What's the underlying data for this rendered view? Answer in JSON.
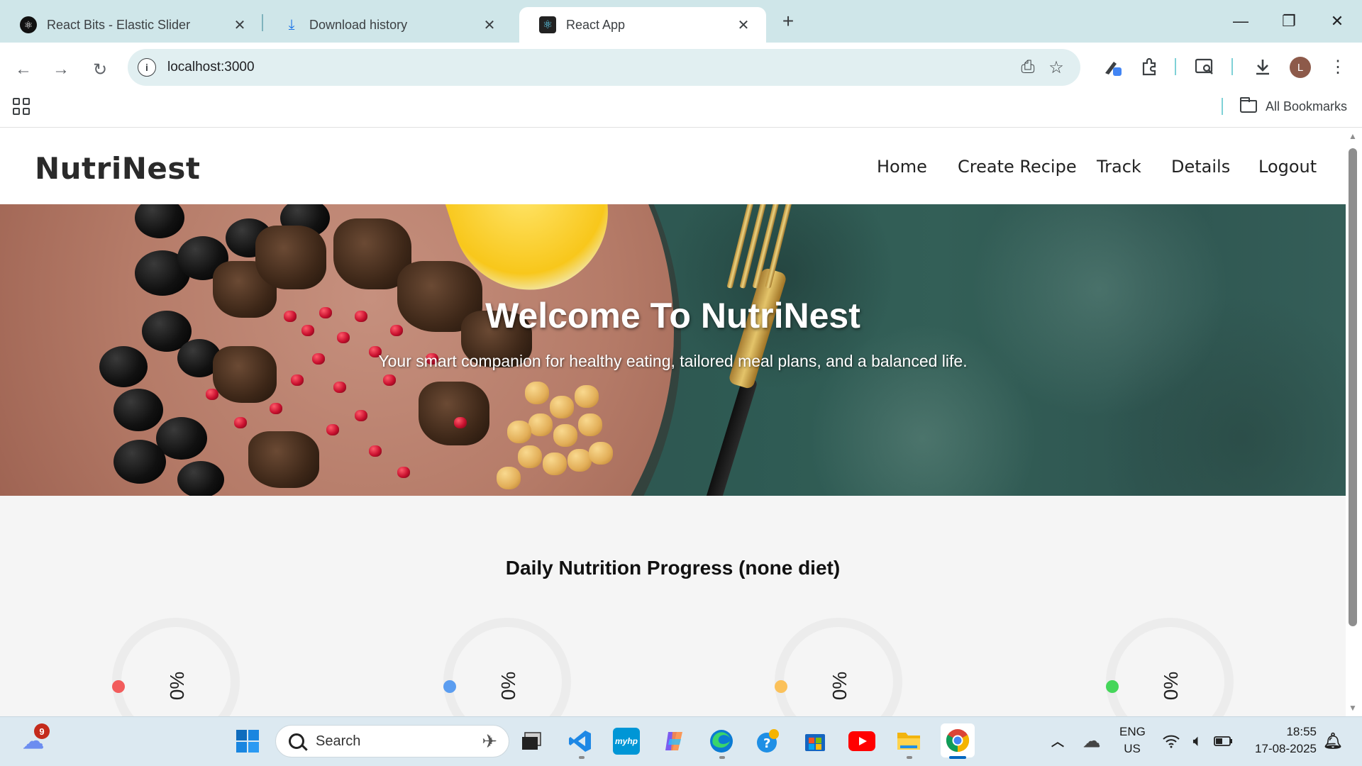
{
  "browser": {
    "tabs": [
      {
        "title": "React Bits - Elastic Slider",
        "icon": "react-bits-icon",
        "active": false
      },
      {
        "title": "Download history",
        "icon": "download-icon",
        "active": false
      },
      {
        "title": "React App",
        "icon": "react-icon",
        "active": true
      }
    ],
    "close_glyph": "✕",
    "new_tab_glyph": "+",
    "url": "localhost:3000",
    "bookmarks_label": "All Bookmarks",
    "profile_initial": "L"
  },
  "app": {
    "brand": "NutriNest",
    "nav": [
      "Home",
      "Create Recipe",
      "Track",
      "Details",
      "Logout"
    ],
    "hero": {
      "title": "Welcome To NutriNest",
      "subtitle": "Your smart companion for healthy eating, tailored meal plans, and a balanced life."
    },
    "progress": {
      "title": "Daily Nutrition Progress (none diet)",
      "items": [
        {
          "color": "#f25c5c",
          "value": "0%"
        },
        {
          "color": "#5b9df0",
          "value": "0%"
        },
        {
          "color": "#fbc15a",
          "value": "0%"
        },
        {
          "color": "#45d65a",
          "value": "0%"
        }
      ]
    }
  },
  "taskbar": {
    "notification_count": "9",
    "search_placeholder": "Search",
    "language": "ENG",
    "region": "US",
    "time": "18:55",
    "date": "17-08-2025"
  }
}
